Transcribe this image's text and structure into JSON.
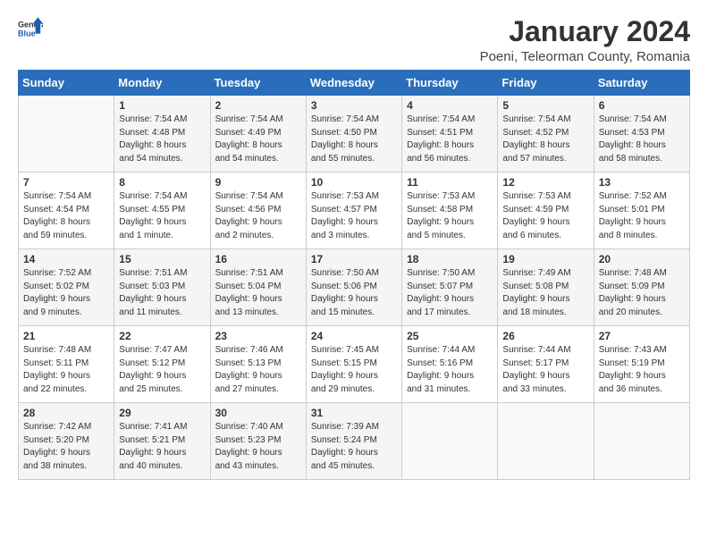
{
  "header": {
    "logo_general": "General",
    "logo_blue": "Blue",
    "month": "January 2024",
    "location": "Poeni, Teleorman County, Romania"
  },
  "days_of_week": [
    "Sunday",
    "Monday",
    "Tuesday",
    "Wednesday",
    "Thursday",
    "Friday",
    "Saturday"
  ],
  "weeks": [
    [
      {
        "day": "",
        "info": ""
      },
      {
        "day": "1",
        "info": "Sunrise: 7:54 AM\nSunset: 4:48 PM\nDaylight: 8 hours\nand 54 minutes."
      },
      {
        "day": "2",
        "info": "Sunrise: 7:54 AM\nSunset: 4:49 PM\nDaylight: 8 hours\nand 54 minutes."
      },
      {
        "day": "3",
        "info": "Sunrise: 7:54 AM\nSunset: 4:50 PM\nDaylight: 8 hours\nand 55 minutes."
      },
      {
        "day": "4",
        "info": "Sunrise: 7:54 AM\nSunset: 4:51 PM\nDaylight: 8 hours\nand 56 minutes."
      },
      {
        "day": "5",
        "info": "Sunrise: 7:54 AM\nSunset: 4:52 PM\nDaylight: 8 hours\nand 57 minutes."
      },
      {
        "day": "6",
        "info": "Sunrise: 7:54 AM\nSunset: 4:53 PM\nDaylight: 8 hours\nand 58 minutes."
      }
    ],
    [
      {
        "day": "7",
        "info": "Sunrise: 7:54 AM\nSunset: 4:54 PM\nDaylight: 8 hours\nand 59 minutes."
      },
      {
        "day": "8",
        "info": "Sunrise: 7:54 AM\nSunset: 4:55 PM\nDaylight: 9 hours\nand 1 minute."
      },
      {
        "day": "9",
        "info": "Sunrise: 7:54 AM\nSunset: 4:56 PM\nDaylight: 9 hours\nand 2 minutes."
      },
      {
        "day": "10",
        "info": "Sunrise: 7:53 AM\nSunset: 4:57 PM\nDaylight: 9 hours\nand 3 minutes."
      },
      {
        "day": "11",
        "info": "Sunrise: 7:53 AM\nSunset: 4:58 PM\nDaylight: 9 hours\nand 5 minutes."
      },
      {
        "day": "12",
        "info": "Sunrise: 7:53 AM\nSunset: 4:59 PM\nDaylight: 9 hours\nand 6 minutes."
      },
      {
        "day": "13",
        "info": "Sunrise: 7:52 AM\nSunset: 5:01 PM\nDaylight: 9 hours\nand 8 minutes."
      }
    ],
    [
      {
        "day": "14",
        "info": "Sunrise: 7:52 AM\nSunset: 5:02 PM\nDaylight: 9 hours\nand 9 minutes."
      },
      {
        "day": "15",
        "info": "Sunrise: 7:51 AM\nSunset: 5:03 PM\nDaylight: 9 hours\nand 11 minutes."
      },
      {
        "day": "16",
        "info": "Sunrise: 7:51 AM\nSunset: 5:04 PM\nDaylight: 9 hours\nand 13 minutes."
      },
      {
        "day": "17",
        "info": "Sunrise: 7:50 AM\nSunset: 5:06 PM\nDaylight: 9 hours\nand 15 minutes."
      },
      {
        "day": "18",
        "info": "Sunrise: 7:50 AM\nSunset: 5:07 PM\nDaylight: 9 hours\nand 17 minutes."
      },
      {
        "day": "19",
        "info": "Sunrise: 7:49 AM\nSunset: 5:08 PM\nDaylight: 9 hours\nand 18 minutes."
      },
      {
        "day": "20",
        "info": "Sunrise: 7:48 AM\nSunset: 5:09 PM\nDaylight: 9 hours\nand 20 minutes."
      }
    ],
    [
      {
        "day": "21",
        "info": "Sunrise: 7:48 AM\nSunset: 5:11 PM\nDaylight: 9 hours\nand 22 minutes."
      },
      {
        "day": "22",
        "info": "Sunrise: 7:47 AM\nSunset: 5:12 PM\nDaylight: 9 hours\nand 25 minutes."
      },
      {
        "day": "23",
        "info": "Sunrise: 7:46 AM\nSunset: 5:13 PM\nDaylight: 9 hours\nand 27 minutes."
      },
      {
        "day": "24",
        "info": "Sunrise: 7:45 AM\nSunset: 5:15 PM\nDaylight: 9 hours\nand 29 minutes."
      },
      {
        "day": "25",
        "info": "Sunrise: 7:44 AM\nSunset: 5:16 PM\nDaylight: 9 hours\nand 31 minutes."
      },
      {
        "day": "26",
        "info": "Sunrise: 7:44 AM\nSunset: 5:17 PM\nDaylight: 9 hours\nand 33 minutes."
      },
      {
        "day": "27",
        "info": "Sunrise: 7:43 AM\nSunset: 5:19 PM\nDaylight: 9 hours\nand 36 minutes."
      }
    ],
    [
      {
        "day": "28",
        "info": "Sunrise: 7:42 AM\nSunset: 5:20 PM\nDaylight: 9 hours\nand 38 minutes."
      },
      {
        "day": "29",
        "info": "Sunrise: 7:41 AM\nSunset: 5:21 PM\nDaylight: 9 hours\nand 40 minutes."
      },
      {
        "day": "30",
        "info": "Sunrise: 7:40 AM\nSunset: 5:23 PM\nDaylight: 9 hours\nand 43 minutes."
      },
      {
        "day": "31",
        "info": "Sunrise: 7:39 AM\nSunset: 5:24 PM\nDaylight: 9 hours\nand 45 minutes."
      },
      {
        "day": "",
        "info": ""
      },
      {
        "day": "",
        "info": ""
      },
      {
        "day": "",
        "info": ""
      }
    ]
  ]
}
